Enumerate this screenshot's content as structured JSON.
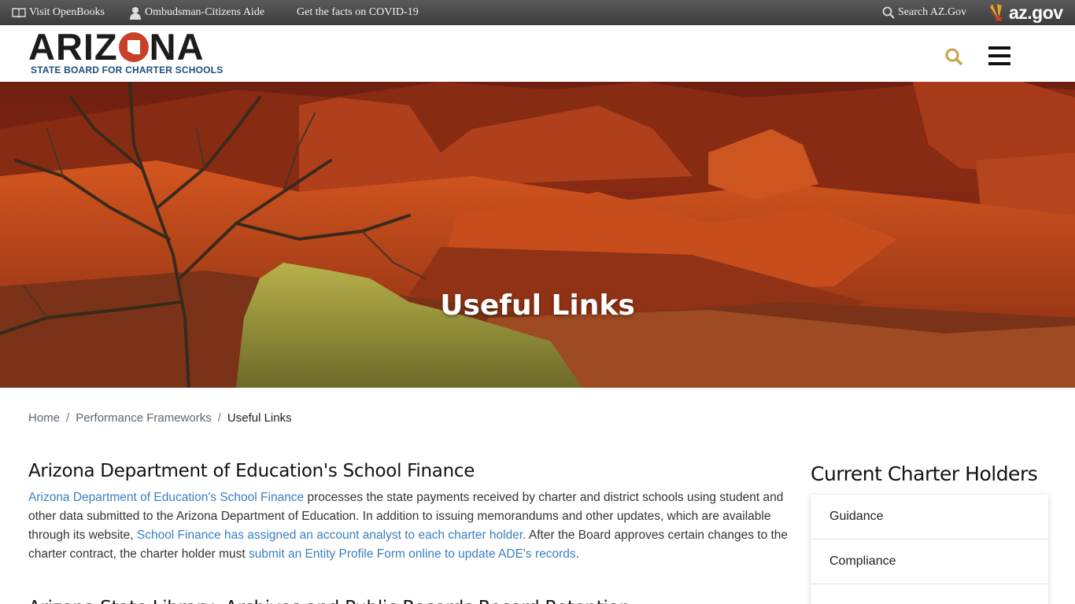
{
  "topbar": {
    "openbooks": "Visit OpenBooks",
    "ombudsman": "Ombudsman-Citizens Aide",
    "covid": "Get the facts on COVID-19",
    "search": "Search AZ.Gov",
    "azgov_logo": "az.gov"
  },
  "header": {
    "logo_word_left": "ARIZ",
    "logo_word_right": "NA",
    "logo_subtitle": "STATE BOARD FOR CHARTER SCHOOLS",
    "search_icon": "search-icon",
    "menu_icon": "hamburger-icon"
  },
  "hero": {
    "title": "Useful Links"
  },
  "breadcrumb": {
    "home": "Home",
    "separator": "/",
    "parent": "Performance Frameworks",
    "current": "Useful Links"
  },
  "main": {
    "heading": "Arizona Department of Education's School Finance",
    "p1_link1": "Arizona Department of Education's School Finance",
    "p1_text1": " processes the state payments received by charter and district schools using student and other data submitted to the Arizona Department of Education. In addition to issuing memorandums and other updates, which are available through its website, ",
    "p1_link2": "School Finance has assigned an account analyst to each charter holder.",
    "p1_text2": " After the Board approves certain changes to the charter contract, the charter holder must ",
    "p1_link3": "submit an Entity Profile Form online to update ADE's records",
    "p1_text3": ".",
    "heading2": "Arizona State Library, Archives and Public Records Record Retention"
  },
  "sidebar": {
    "title": "Current Charter Holders",
    "items": [
      "Guidance",
      "Compliance",
      ""
    ]
  },
  "colors": {
    "topbar": "#4a4a4a",
    "logo_red": "#c8402a",
    "logo_blue": "#1d4f7a",
    "search_gold": "#c9a24a",
    "link_blue": "#3a7fc1"
  }
}
